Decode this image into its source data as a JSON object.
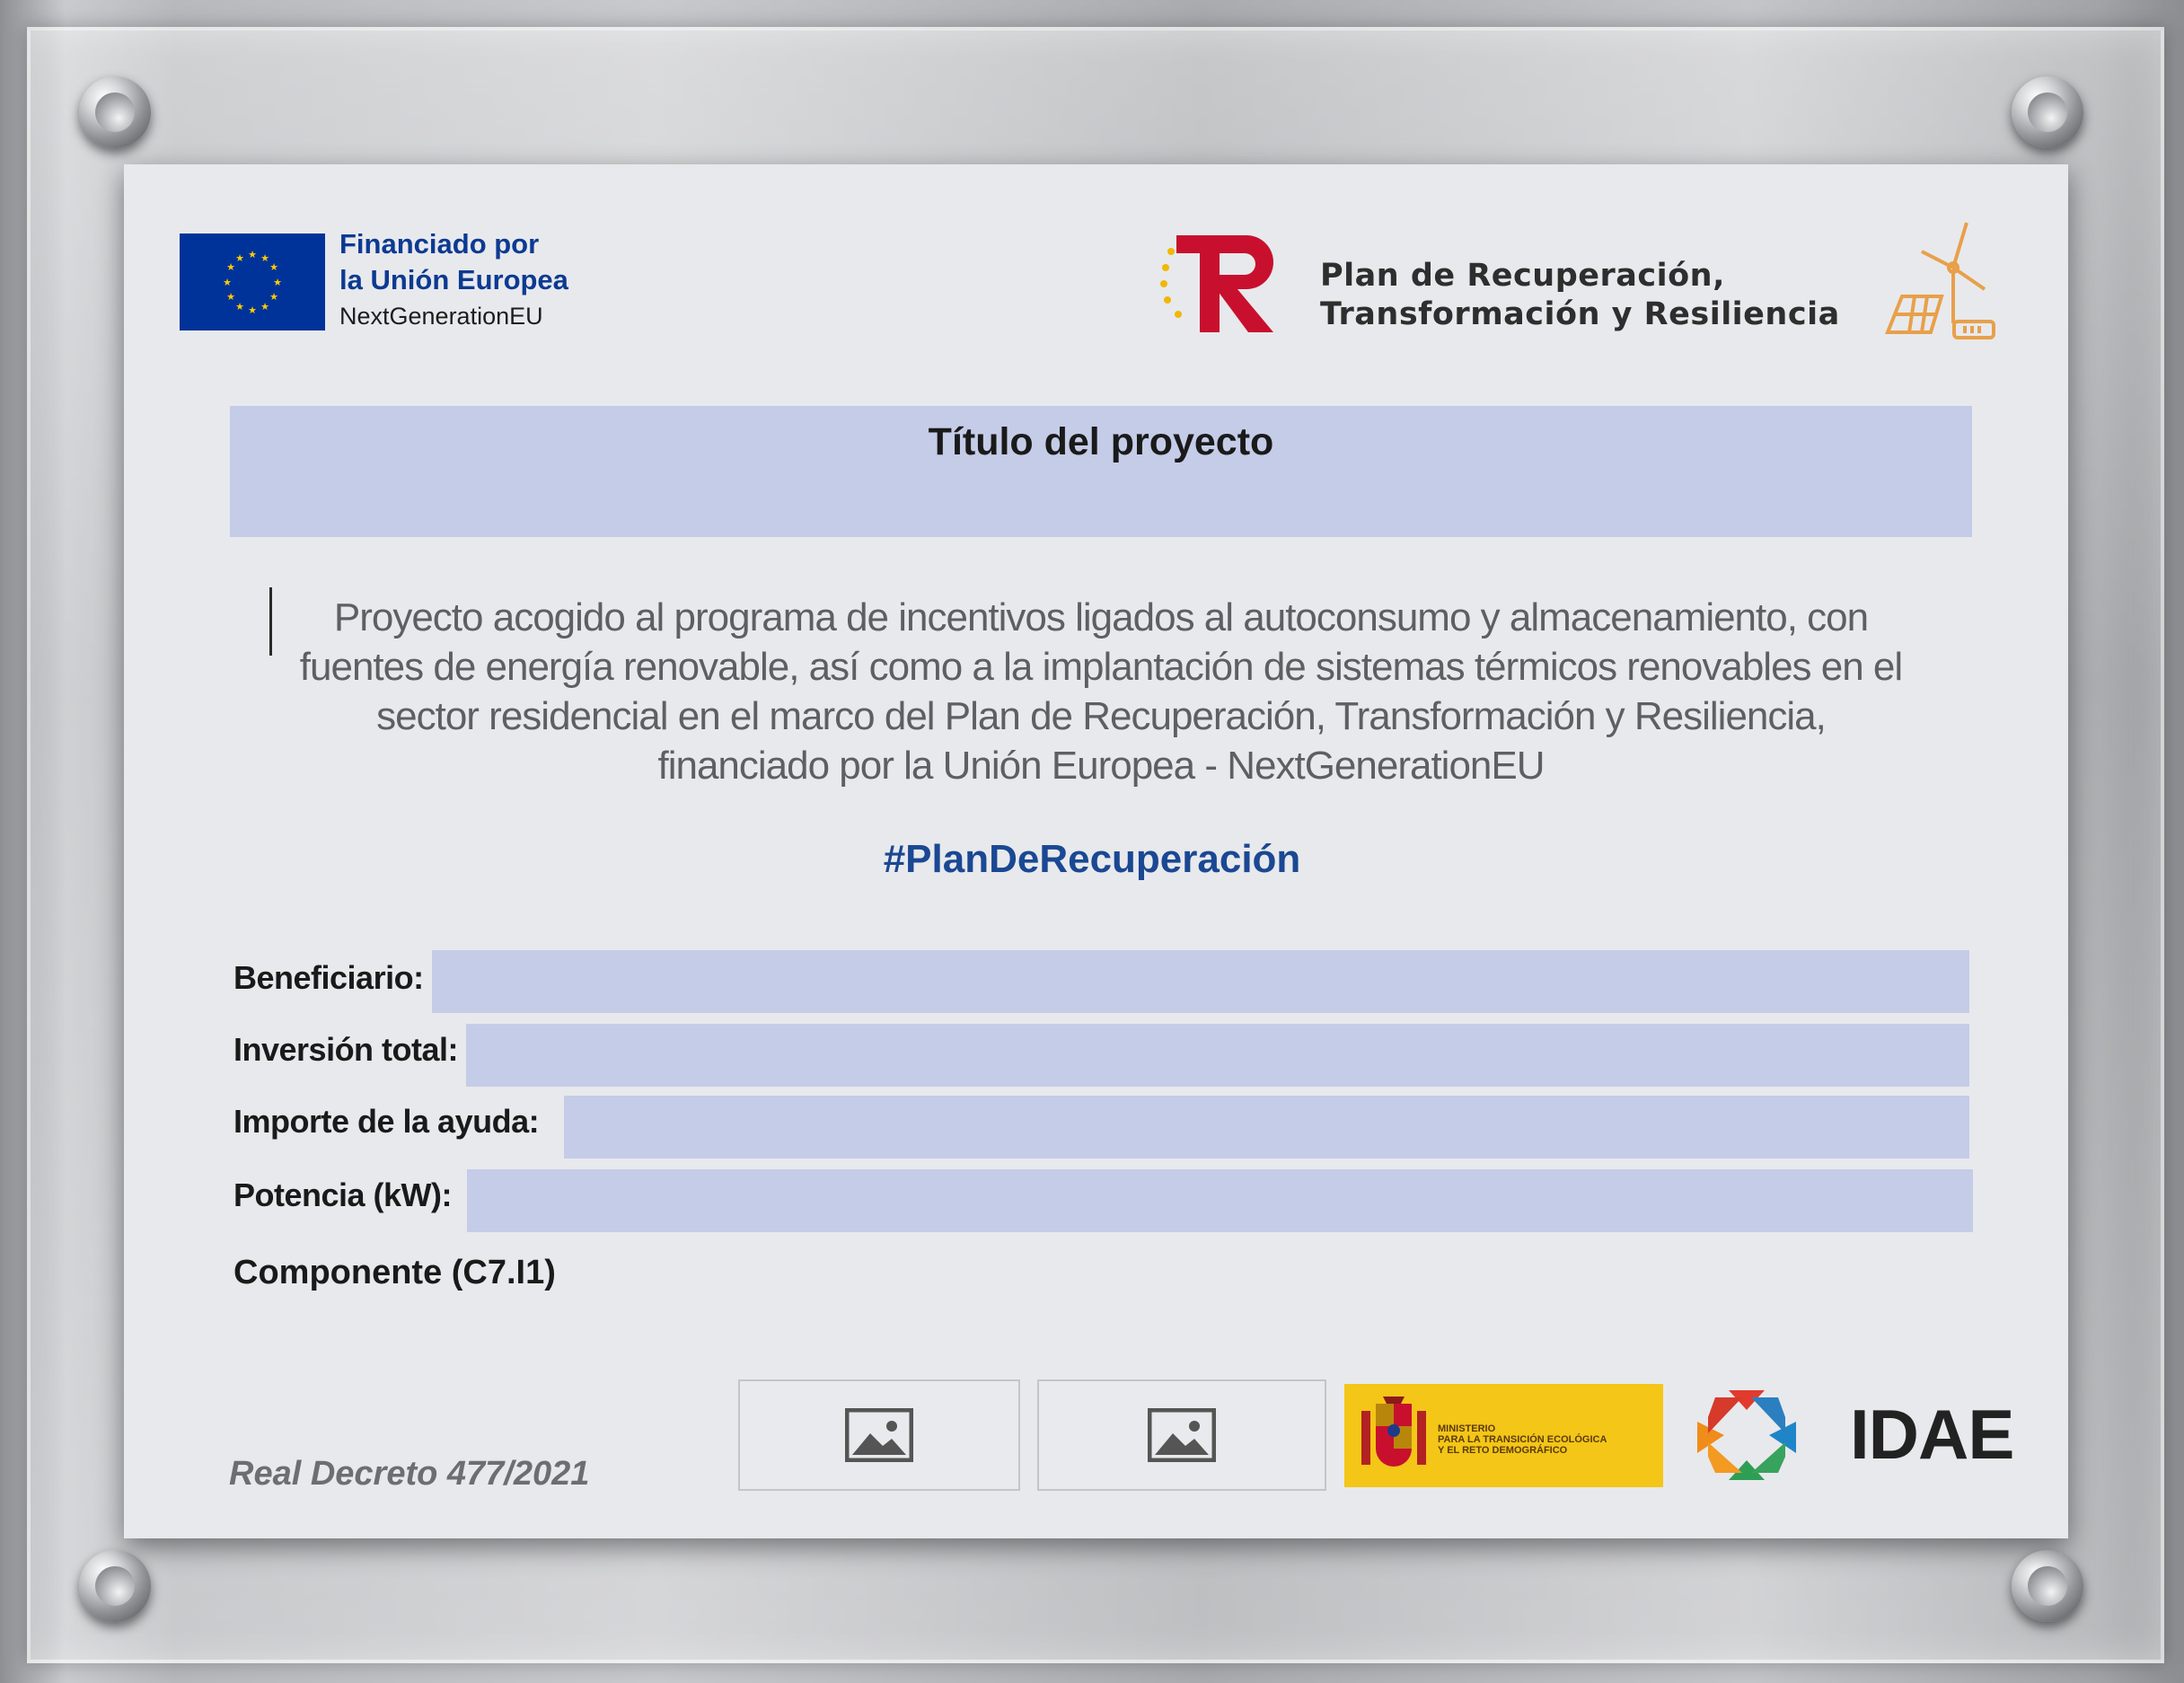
{
  "eu_block": {
    "line1": "Financiado por",
    "line2": "la Unión Europea",
    "line3": "NextGenerationEU"
  },
  "plan_block": {
    "line1": "Plan de Recuperación,",
    "line2": "Transformación y Resiliencia"
  },
  "project": {
    "title": "Título del proyecto",
    "description_lines": [
      "Proyecto acogido al programa de incentivos ligados al autoconsumo y almacenamiento, con",
      "fuentes de energía renovable, así como a la implantación de sistemas térmicos renovables en el",
      "sector residencial en el marco del Plan de Recuperación, Transformación y Resiliencia,",
      "financiado por la Unión Europea - NextGenerationEU"
    ],
    "hashtag": "#PlanDeRecuperación"
  },
  "fields": {
    "beneficiario": "Beneficiario:",
    "inversion": "Inversión total:",
    "importe": "Importe de la ayuda:",
    "potencia": "Potencia (kW):",
    "componente": "Componente (C7.I1)"
  },
  "footer": {
    "decreto": "Real Decreto 477/2021",
    "ministry_lines": [
      "MINISTERIO",
      "PARA LA TRANSICIÓN ECOLÓGICA",
      "Y EL RETO DEMOGRÁFICO"
    ],
    "idae": "IDAE"
  },
  "colors": {
    "field_fill": "#c5cce8",
    "eu_blue": "#003399",
    "hashtag_blue": "#1a4893",
    "ministry_yellow": "#f3c617"
  }
}
